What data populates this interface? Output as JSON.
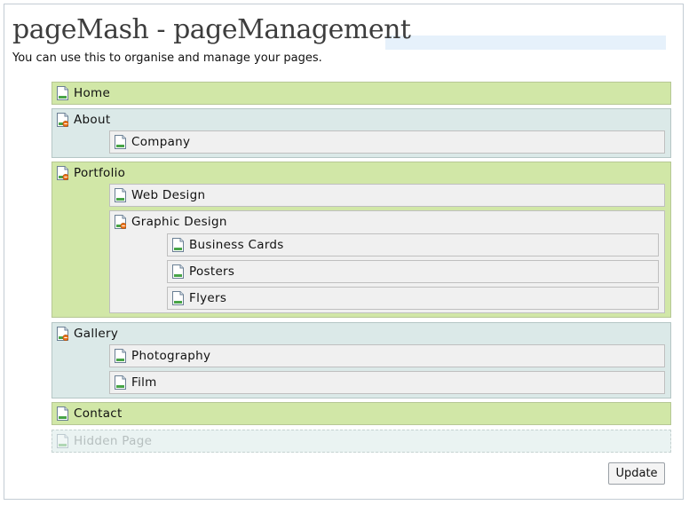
{
  "header": {
    "title": "pageMash - pageManagement",
    "subtitle": "You can use this to organise and manage your pages."
  },
  "pages": [
    {
      "label": "Home",
      "level": 0,
      "has_children": false,
      "color": "#d1e7a7"
    },
    {
      "label": "About",
      "level": 0,
      "has_children": true,
      "color": "#dbe9e8",
      "children": [
        {
          "label": "Company",
          "level": 1,
          "has_children": false
        }
      ]
    },
    {
      "label": "Portfolio",
      "level": 0,
      "has_children": true,
      "color": "#d1e7a7",
      "children": [
        {
          "label": "Web Design",
          "level": 1,
          "has_children": false
        },
        {
          "label": "Graphic Design",
          "level": 1,
          "has_children": true,
          "children": [
            {
              "label": "Business Cards",
              "level": 2,
              "has_children": false
            },
            {
              "label": "Posters",
              "level": 2,
              "has_children": false
            },
            {
              "label": "Flyers",
              "level": 2,
              "has_children": false
            }
          ]
        }
      ]
    },
    {
      "label": "Gallery",
      "level": 0,
      "has_children": true,
      "color": "#dbe9e8",
      "children": [
        {
          "label": "Photography",
          "level": 1,
          "has_children": false
        },
        {
          "label": "Film",
          "level": 1,
          "has_children": false
        }
      ]
    },
    {
      "label": "Contact",
      "level": 0,
      "has_children": false,
      "color": "#d1e7a7"
    },
    {
      "label": "Hidden Page",
      "level": 0,
      "has_children": false,
      "hidden": true,
      "color": "#eaf3f2"
    }
  ],
  "actions": {
    "update_label": "Update"
  },
  "icons": {
    "page": "page-icon",
    "folder": "page-with-children-icon"
  }
}
